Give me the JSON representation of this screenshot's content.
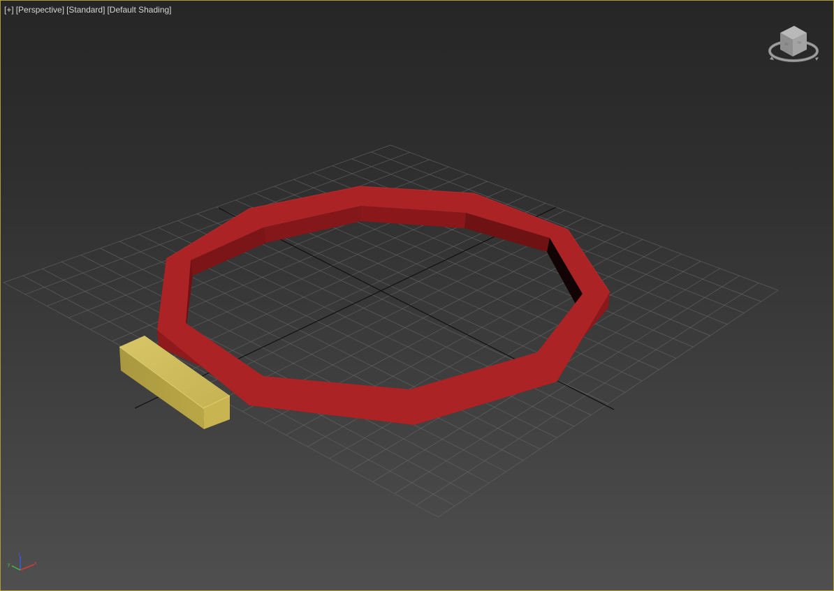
{
  "viewport": {
    "menu_plus": "[+]",
    "menu_view": "[Perspective]",
    "menu_standard": "[Standard]",
    "menu_shading": "[Default Shading]"
  },
  "scene_objects": [
    {
      "name": "decagon-ring",
      "color": "#a82224"
    },
    {
      "name": "box",
      "color": "#c9b654"
    }
  ],
  "colors": {
    "viewport_border": "#b39a3a",
    "grid_line": "#6a6a6a",
    "axis_line": "#0a0a0a",
    "label_text": "#d6d6d6"
  },
  "icons": {
    "viewcube": "viewcube-icon",
    "axis_tripod": "axis-tripod-icon"
  },
  "axis_labels": {
    "x": "x",
    "y": "y",
    "z": "z"
  }
}
